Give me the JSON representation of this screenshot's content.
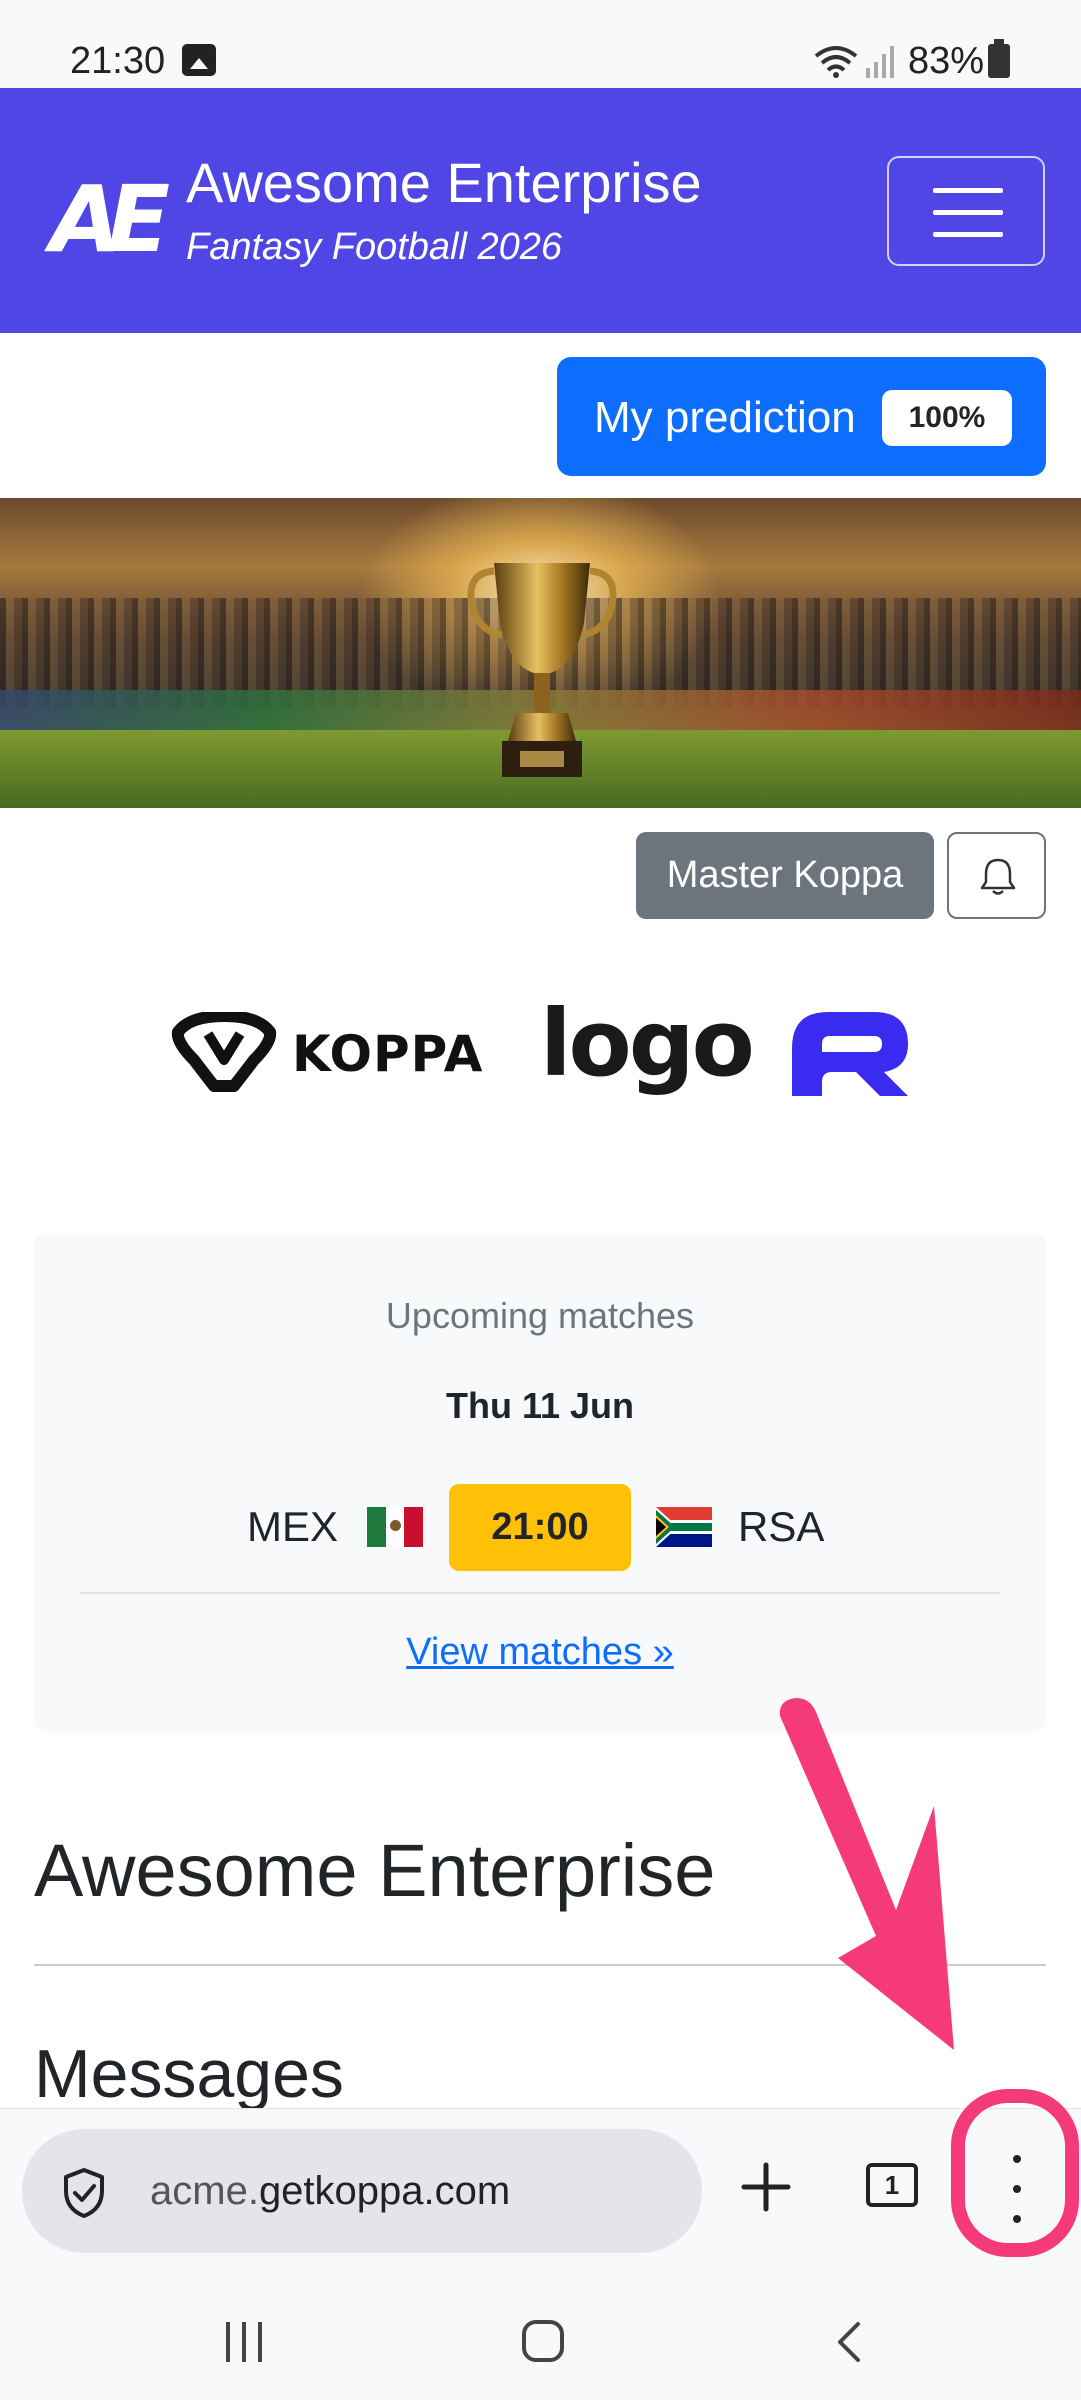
{
  "status_bar": {
    "time": "21:30",
    "battery": "83%",
    "icons": [
      "image-icon",
      "wifi-icon",
      "signal-icon",
      "battery-icon"
    ]
  },
  "navbar": {
    "logo_text": "AE",
    "title": "Awesome Enterprise",
    "subtitle": "Fantasy Football 2026",
    "background": "#4f46e5",
    "menu_icon": "hamburger-menu-icon"
  },
  "prediction": {
    "label": "My prediction",
    "badge": "100%",
    "color": "#0d6efd"
  },
  "hero": {
    "image": "trophy-in-stadium-banner"
  },
  "actions": {
    "master_label": "Master Koppa",
    "bell_icon": "bell-icon"
  },
  "sponsors": {
    "koppa": "KOPPA",
    "logo": "logo",
    "third": "r-brand-logo"
  },
  "upcoming": {
    "title": "Upcoming matches",
    "date": "Thu 11 Jun",
    "home_team": "MEX",
    "kickoff": "21:00",
    "away_team": "RSA",
    "link": "View matches »",
    "kickoff_color": "#ffc107"
  },
  "content": {
    "company_heading": "Awesome Enterprise",
    "messages_heading": "Messages"
  },
  "browser": {
    "url_prefix": "acme.",
    "url_domain": "getkoppa.com",
    "tab_count": "1",
    "security_icon": "shield-check-icon",
    "new_tab_icon": "plus-icon",
    "menu_icon": "more-vertical-icon"
  },
  "annotation": {
    "color": "#f53a7a"
  }
}
